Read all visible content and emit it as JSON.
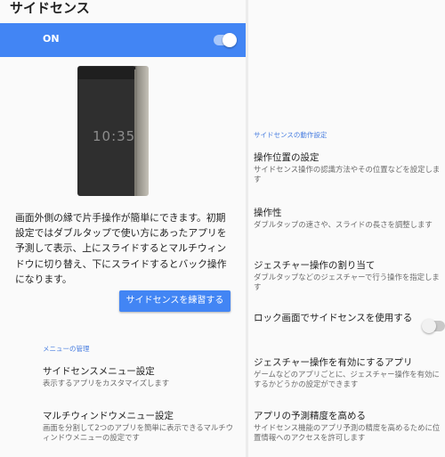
{
  "left": {
    "title": "サイドセンス",
    "master": {
      "label": "ON",
      "state": "on"
    },
    "phone_clock": "10:35",
    "description": "画面外側の縁で片手操作が簡単にできます。初期設定ではダブルタップで使い方にあったアプリを予測して表示、上にスライドするとマルチウィンドウに切り替え、下にスライドするとバック操作になります。",
    "practice_button": "サイドセンスを練習する",
    "section": "メニューの管理",
    "items": [
      {
        "title": "サイドセンスメニュー設定",
        "subtitle": "表示するアプリをカスタマイズします"
      },
      {
        "title": "マルチウィンドウメニュー設定",
        "subtitle": "画面を分割して2つのアプリを簡単に表示できるマルチウィンドウメニューの設定です"
      }
    ]
  },
  "right": {
    "section": "サイドセンスの動作設定",
    "items": [
      {
        "title": "操作位置の設定",
        "subtitle": "サイドセンス操作の認識方法やその位置などを設定します"
      },
      {
        "title": "操作性",
        "subtitle": "ダブルタップの速さや、スライドの長さを調整します"
      },
      {
        "title": "ジェスチャー操作の割り当て",
        "subtitle": "ダブルタップなどのジェスチャーで行う操作を指定します"
      },
      {
        "title": "ロック画面でサイドセンスを使用する",
        "subtitle": "",
        "toggle": "off"
      },
      {
        "title": "ジェスチャー操作を有効にするアプリ",
        "subtitle": "ゲームなどのアプリごとに、ジェスチャー操作を有効にするかどうかの設定ができます"
      },
      {
        "title": "アプリの予測精度を高める",
        "subtitle": "サイドセンス機能のアプリ予測の精度を高めるために位置情報へのアクセスを許可します"
      }
    ]
  },
  "colors": {
    "accent": "#4285f4",
    "section_text": "#4a7fe0"
  }
}
